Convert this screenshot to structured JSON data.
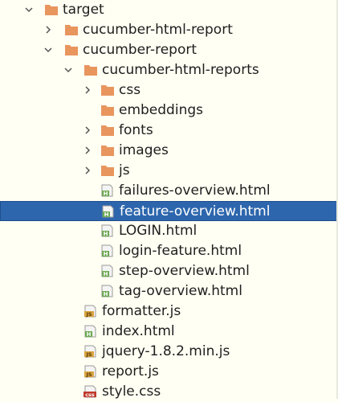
{
  "tree": {
    "rows": [
      {
        "label": "target",
        "kind": "folder",
        "arrow": "down",
        "depth": 0,
        "selected": false
      },
      {
        "label": "cucumber-html-report",
        "kind": "folder",
        "arrow": "right",
        "depth": 1,
        "selected": false
      },
      {
        "label": "cucumber-report",
        "kind": "folder",
        "arrow": "down",
        "depth": 1,
        "selected": false
      },
      {
        "label": "cucumber-html-reports",
        "kind": "folder",
        "arrow": "down",
        "depth": 2,
        "selected": false
      },
      {
        "label": "css",
        "kind": "folder",
        "arrow": "right",
        "depth": 3,
        "selected": false
      },
      {
        "label": "embeddings",
        "kind": "folder",
        "arrow": "none",
        "depth": 3,
        "selected": false
      },
      {
        "label": "fonts",
        "kind": "folder",
        "arrow": "right",
        "depth": 3,
        "selected": false
      },
      {
        "label": "images",
        "kind": "folder",
        "arrow": "right",
        "depth": 3,
        "selected": false
      },
      {
        "label": "js",
        "kind": "folder",
        "arrow": "right",
        "depth": 3,
        "selected": false
      },
      {
        "label": "failures-overview.html",
        "kind": "html",
        "arrow": "none",
        "depth": 3,
        "selected": false
      },
      {
        "label": "feature-overview.html",
        "kind": "html",
        "arrow": "none",
        "depth": 3,
        "selected": true
      },
      {
        "label": "LOGIN.html",
        "kind": "html",
        "arrow": "none",
        "depth": 3,
        "selected": false
      },
      {
        "label": "login-feature.html",
        "kind": "html",
        "arrow": "none",
        "depth": 3,
        "selected": false
      },
      {
        "label": "step-overview.html",
        "kind": "html",
        "arrow": "none",
        "depth": 3,
        "selected": false
      },
      {
        "label": "tag-overview.html",
        "kind": "html",
        "arrow": "none",
        "depth": 3,
        "selected": false
      },
      {
        "label": "formatter.js",
        "kind": "js",
        "arrow": "none",
        "depth": 2,
        "selected": false
      },
      {
        "label": "index.html",
        "kind": "html",
        "arrow": "none",
        "depth": 2,
        "selected": false
      },
      {
        "label": "jquery-1.8.2.min.js",
        "kind": "js",
        "arrow": "none",
        "depth": 2,
        "selected": false
      },
      {
        "label": "report.js",
        "kind": "js",
        "arrow": "none",
        "depth": 2,
        "selected": false
      },
      {
        "label": "style.css",
        "kind": "css",
        "arrow": "none",
        "depth": 2,
        "selected": false
      }
    ]
  },
  "colors": {
    "background": "#fffff3",
    "selection": "#2d66ad",
    "folder": "#e8955e",
    "html_icon": "#6aa84f",
    "js_icon": "#d9a441",
    "css_icon": "#c0392b",
    "arrow": "#555555"
  },
  "icons": {
    "folder": "folder-icon",
    "html": "html-file-icon",
    "js": "js-file-icon",
    "css": "css-file-icon",
    "down": "chevron-down-icon",
    "right": "chevron-right-icon"
  },
  "icon_glyphs": {
    "html": "H",
    "js": "JS",
    "css": "css"
  }
}
